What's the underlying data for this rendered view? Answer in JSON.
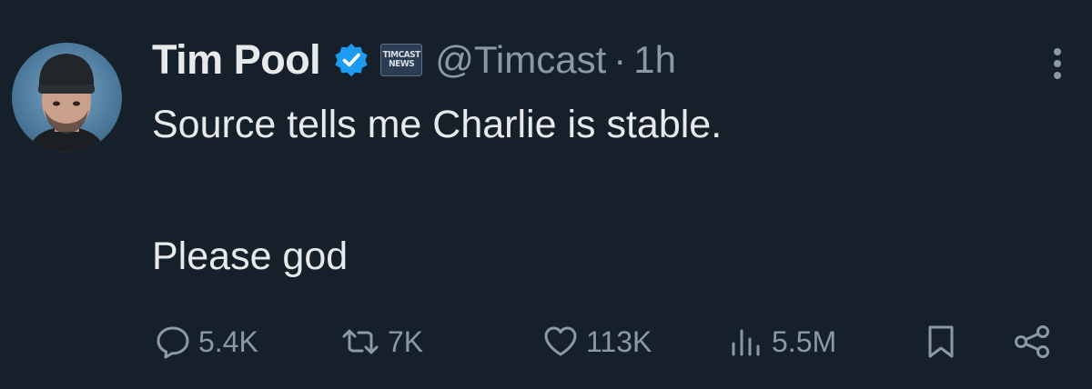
{
  "author": {
    "name": "Tim Pool",
    "handle": "@Timcast",
    "separator": "·",
    "time": "1h",
    "affiliate_badge": [
      "TIMCAST",
      "NEWS"
    ],
    "verified_color": "#1d9bf0"
  },
  "tweet": {
    "lines": [
      "Source tells me Charlie is stable.",
      "Please god"
    ]
  },
  "actions": {
    "replies": "5.4K",
    "reposts": "7K",
    "likes": "113K",
    "views": "5.5M"
  },
  "icons": [
    "more-icon",
    "reply-icon",
    "repost-icon",
    "like-icon",
    "views-icon",
    "bookmark-icon",
    "share-icon"
  ],
  "colors": {
    "background": "#15202b",
    "text": "#e7e9ea",
    "muted": "#8b98a5"
  }
}
